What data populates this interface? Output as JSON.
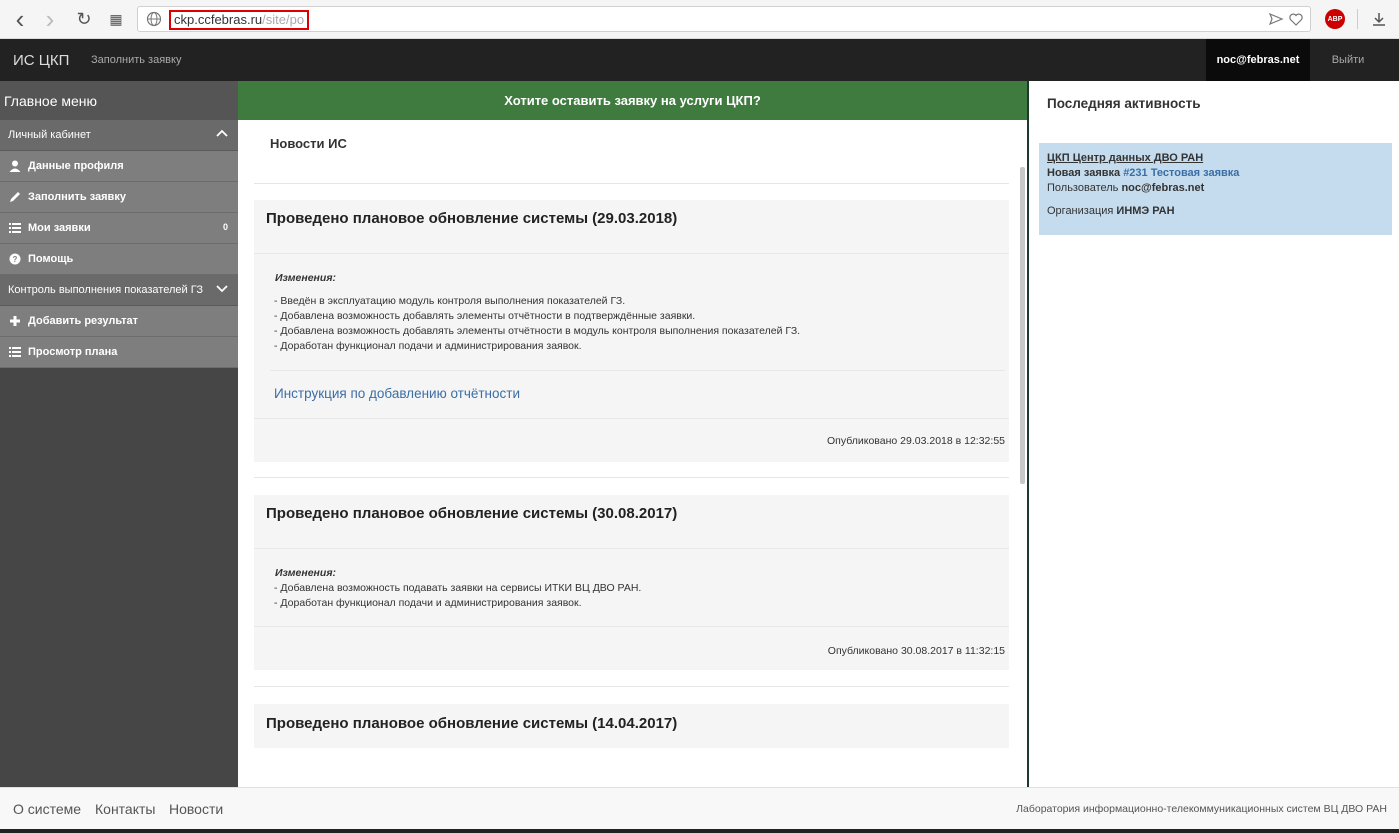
{
  "browser": {
    "url_host": "ckp.ccfebras.ru",
    "url_path": "/site/po",
    "back_glyph": "‹",
    "forward_glyph": "›",
    "reload_glyph": "↻",
    "tabs_glyph": "▦",
    "adblock_label": "ABP"
  },
  "navbar": {
    "brand": "ИС ЦКП",
    "fill_request": "Заполнить заявку",
    "user": "noc@febras.net",
    "logout": "Выйти"
  },
  "sidebar": {
    "title": "Главное меню",
    "group1": {
      "label": "Личный кабинет",
      "chevron": "^"
    },
    "items1": [
      {
        "label": "Данные профиля",
        "icon": "user-icon"
      },
      {
        "label": "Заполнить заявку",
        "icon": "pencil-icon"
      },
      {
        "label": "Мои заявки",
        "icon": "list-icon",
        "badge": "0"
      },
      {
        "label": "Помощь",
        "icon": "question-icon"
      }
    ],
    "group2": {
      "label": "Контроль выполнения показателей ГЗ",
      "chevron": "v"
    },
    "items2": [
      {
        "label": "Добавить результат",
        "icon": "plus-icon"
      },
      {
        "label": "Просмотр плана",
        "icon": "list-icon"
      }
    ]
  },
  "main": {
    "cta": "Хотите оставить заявку на услуги ЦКП?",
    "news_heading": "Новости ИС",
    "news": [
      {
        "title": "Проведено плановое обновление системы (29.03.2018)",
        "changes_label": "Изменения:",
        "changes": [
          "- Введён в эксплуатацию модуль контроля выполнения показателей ГЗ.",
          "- Добавлена возможность добавлять элементы отчётности в подтверждённые заявки.",
          "- Добавлена возможность добавлять элементы отчётности в модуль контроля выполнения показателей ГЗ.",
          "- Доработан функционал подачи и администрирования заявок."
        ],
        "link": "Инструкция по добавлению отчётности",
        "published": "Опубликовано 29.03.2018 в 12:32:55"
      },
      {
        "title": "Проведено плановое обновление системы (30.08.2017)",
        "changes_label": "Изменения:",
        "changes": [
          "- Добавлена возможность подавать заявки на сервисы ИТКИ ВЦ ДВО РАН.",
          "- Доработан функционал подачи и администрирования заявок."
        ],
        "published": "Опубликовано 30.08.2017 в 11:32:15"
      },
      {
        "title": "Проведено плановое обновление системы (14.04.2017)"
      }
    ]
  },
  "right": {
    "heading": "Последняя активность",
    "activity": {
      "org": "ЦКП Центр данных ДВО РАН",
      "req_label": "Новая заявка",
      "req_link": "#231 Тестовая заявка",
      "user_label": "Пользователь",
      "user": "noc@febras.net",
      "org_label": "Организация",
      "org_value": "ИНМЭ РАН"
    }
  },
  "footer": {
    "links": [
      "О системе",
      "Контакты",
      "Новости"
    ],
    "right": "Лаборатория информационно-телекоммуникационных систем ВЦ ДВО РАН"
  }
}
